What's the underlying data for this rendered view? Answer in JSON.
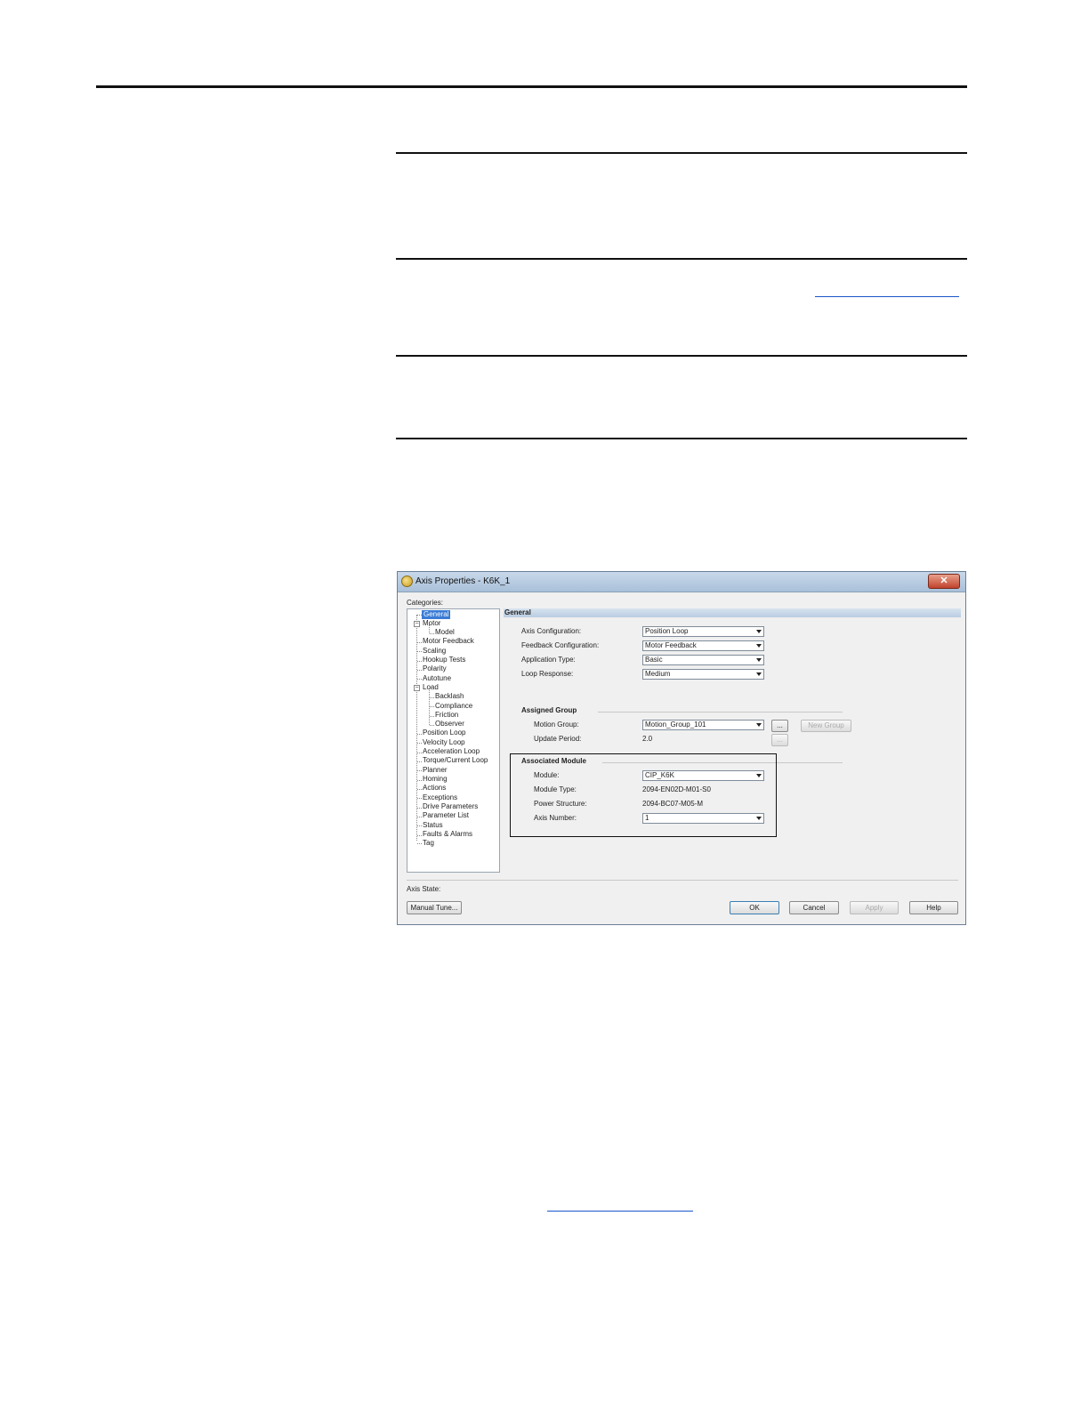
{
  "dialog": {
    "title": "Axis Properties - K6K_1",
    "close_glyph": "✕",
    "categories_label": "Categories:",
    "tree": [
      {
        "label": "General",
        "selected": true
      },
      {
        "label": "Motor",
        "expander": "−"
      },
      {
        "label": "Model"
      },
      {
        "label": "Motor Feedback"
      },
      {
        "label": "Scaling"
      },
      {
        "label": "Hookup Tests"
      },
      {
        "label": "Polarity"
      },
      {
        "label": "Autotune"
      },
      {
        "label": "Load",
        "expander": "−"
      },
      {
        "label": "Backlash"
      },
      {
        "label": "Compliance"
      },
      {
        "label": "Friction"
      },
      {
        "label": "Observer"
      },
      {
        "label": "Position Loop"
      },
      {
        "label": "Velocity Loop"
      },
      {
        "label": "Acceleration Loop"
      },
      {
        "label": "Torque/Current Loop"
      },
      {
        "label": "Planner"
      },
      {
        "label": "Homing"
      },
      {
        "label": "Actions"
      },
      {
        "label": "Exceptions"
      },
      {
        "label": "Drive Parameters"
      },
      {
        "label": "Parameter List"
      },
      {
        "label": "Status"
      },
      {
        "label": "Faults & Alarms"
      },
      {
        "label": "Tag"
      }
    ],
    "general": {
      "header": "General",
      "axis_configuration": {
        "label": "Axis Configuration:",
        "value": "Position Loop"
      },
      "feedback_configuration": {
        "label": "Feedback Configuration:",
        "value": "Motor Feedback"
      },
      "application_type": {
        "label": "Application Type:",
        "value": "Basic"
      },
      "loop_response": {
        "label": "Loop Response:",
        "value": "Medium"
      }
    },
    "assigned_group": {
      "header": "Assigned Group",
      "motion_group": {
        "label": "Motion Group:",
        "value": "Motion_Group_101"
      },
      "ellipsis_label": "...",
      "new_group_label": "New Group",
      "update_period": {
        "label": "Update Period:",
        "value": "2.0"
      }
    },
    "associated_module": {
      "header": "Associated Module",
      "module": {
        "label": "Module:",
        "value": "CIP_K6K"
      },
      "module_type": {
        "label": "Module Type:",
        "value": "2094-EN02D-M01-S0"
      },
      "power_structure": {
        "label": "Power Structure:",
        "value": "2094-BC07-M05-M"
      },
      "axis_number": {
        "label": "Axis Number:",
        "value": "1"
      }
    },
    "axis_state_label": "Axis State:",
    "buttons": {
      "manual_tune": "Manual Tune...",
      "ok": "OK",
      "cancel": "Cancel",
      "apply": "Apply",
      "help": "Help"
    }
  }
}
